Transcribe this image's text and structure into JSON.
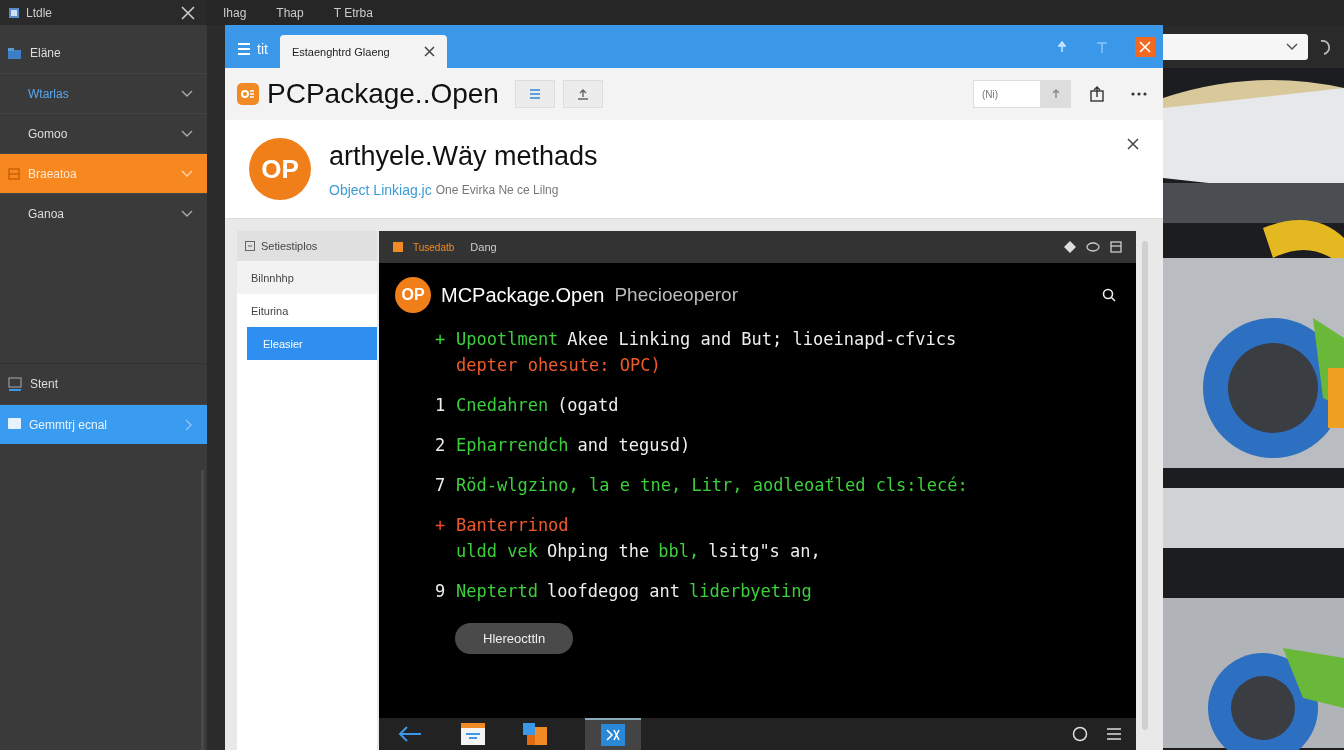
{
  "sidebar": {
    "title": "Ltdle",
    "header": "Eläne",
    "nav_items": [
      {
        "label": "Wtarlas",
        "selected": false,
        "highlighted": true,
        "icon": false
      },
      {
        "label": "Gomoo",
        "selected": false,
        "highlighted": false,
        "icon": false
      },
      {
        "label": "Braeatoa",
        "selected": true,
        "highlighted": false,
        "icon": true
      },
      {
        "label": "Ganoa",
        "selected": false,
        "highlighted": false,
        "icon": false
      }
    ],
    "footer_header": "Stent",
    "footer_items": [
      {
        "label": "Gemmtrj ecnal",
        "selected": true
      }
    ]
  },
  "menu_bar": [
    "Ihag",
    "Thap",
    "T Etrba"
  ],
  "window": {
    "app_label": "tit",
    "tab": {
      "label": "Estaenghtrd Glaeng"
    },
    "toolbar": {
      "title": "PCPackage..Open",
      "search": {
        "placeholder": "(Ni)"
      }
    },
    "header_card": {
      "logo": "OP",
      "title": "arthyele.Wäy methads",
      "subtitle_link": "Object Linkiag.jc",
      "subtitle": "One Evirka Ne ce Lilng"
    },
    "list_panel": {
      "header": "Setiestiplos",
      "items": [
        {
          "label": "Bilnnhhp",
          "selected": false
        },
        {
          "label": "Eiturina",
          "selected": false
        },
        {
          "label": "Eleasier",
          "selected": true
        }
      ]
    },
    "terminal": {
      "tab": "Tusedatb",
      "title": "Dang",
      "logo": "OP",
      "app_name": "MCPackage.Open",
      "app_subtitle": "Phecioeoperor",
      "lines": [
        {
          "marker": "+",
          "kind": "add",
          "segments": [
            {
              "kind": "keyword",
              "text": "Upootlment"
            },
            {
              "kind": "plain",
              "text": "Akee Linking and But; lioeinapd-cfvics"
            }
          ],
          "continuation": [
            {
              "kind": "error",
              "text": "depter ohesute: OPC)"
            }
          ]
        },
        {
          "marker": "1",
          "kind": "number",
          "segments": [
            {
              "kind": "keyword",
              "text": "Cnedahren"
            },
            {
              "kind": "plain",
              "text": "(ogatd"
            }
          ]
        },
        {
          "marker": "2",
          "kind": "number",
          "segments": [
            {
              "kind": "keyword",
              "text": "Epharrendch"
            },
            {
              "kind": "plain",
              "text": "and tegusd)"
            }
          ]
        },
        {
          "marker": "7",
          "kind": "number",
          "segments": [
            {
              "kind": "keyword",
              "text": "Röd-wlgzino, la e tne, Litr, aodleoaťled cls:lecé:"
            }
          ]
        },
        {
          "marker": "+",
          "kind": "remove",
          "segments": [
            {
              "kind": "error",
              "text": "Banterrinod"
            }
          ],
          "continuation": [
            {
              "kind": "keyword",
              "text": "uldd vek"
            },
            {
              "kind": "plain",
              "text": "Ohping the"
            },
            {
              "kind": "keyword",
              "text": "bbl,"
            },
            {
              "kind": "plain",
              "text": "lsitg\"s an,"
            }
          ]
        },
        {
          "marker": "9",
          "kind": "number",
          "segments": [
            {
              "kind": "keyword",
              "text": "Neptertd"
            },
            {
              "kind": "plain",
              "text": "loofdegog ant"
            },
            {
              "kind": "keyword",
              "text": "liderbyeting"
            }
          ]
        }
      ],
      "button": "Hlereocttln"
    }
  }
}
